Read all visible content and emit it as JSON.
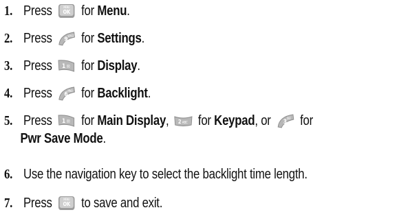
{
  "steps": [
    {
      "num": "1.",
      "t1": "Press",
      "t2": "for",
      "b1": "Menu",
      "end": "."
    },
    {
      "num": "2.",
      "t1": "Press",
      "t2": "for",
      "b1": "Settings",
      "end": "."
    },
    {
      "num": "3.",
      "t1": "Press",
      "t2": "for",
      "b1": "Display",
      "end": "."
    },
    {
      "num": "4.",
      "t1": "Press",
      "t2": "for",
      "b1": "Backlight",
      "end": "."
    },
    {
      "num": "5.",
      "t1": "Press",
      "t2": "for",
      "b1": "Main Display",
      "c1": ",",
      "t3": "for",
      "b2": "Keypad",
      "c2": ", or",
      "t4": "for",
      "b3": "Pwr Save Mode",
      "end": "."
    },
    {
      "num": "6.",
      "text": "Use the navigation key to select the backlight time length."
    },
    {
      "num": "7.",
      "t1": "Press",
      "t2": "to save and exit."
    }
  ],
  "keys": {
    "menu_ok": {
      "top": "MENU",
      "main": "OK"
    },
    "nine": {
      "num": "9",
      "letters": "WXYZ"
    },
    "one": {
      "num": "1",
      "letters": "✉"
    },
    "six": {
      "num": "6",
      "letters": "MNO"
    },
    "two": {
      "num": "2",
      "letters": "ABC"
    },
    "three": {
      "num": "3",
      "letters": "DEF"
    }
  },
  "colors": {
    "key_fill": "#bdbdbd",
    "key_shade": "#7a7a7a",
    "text": "#111111"
  }
}
